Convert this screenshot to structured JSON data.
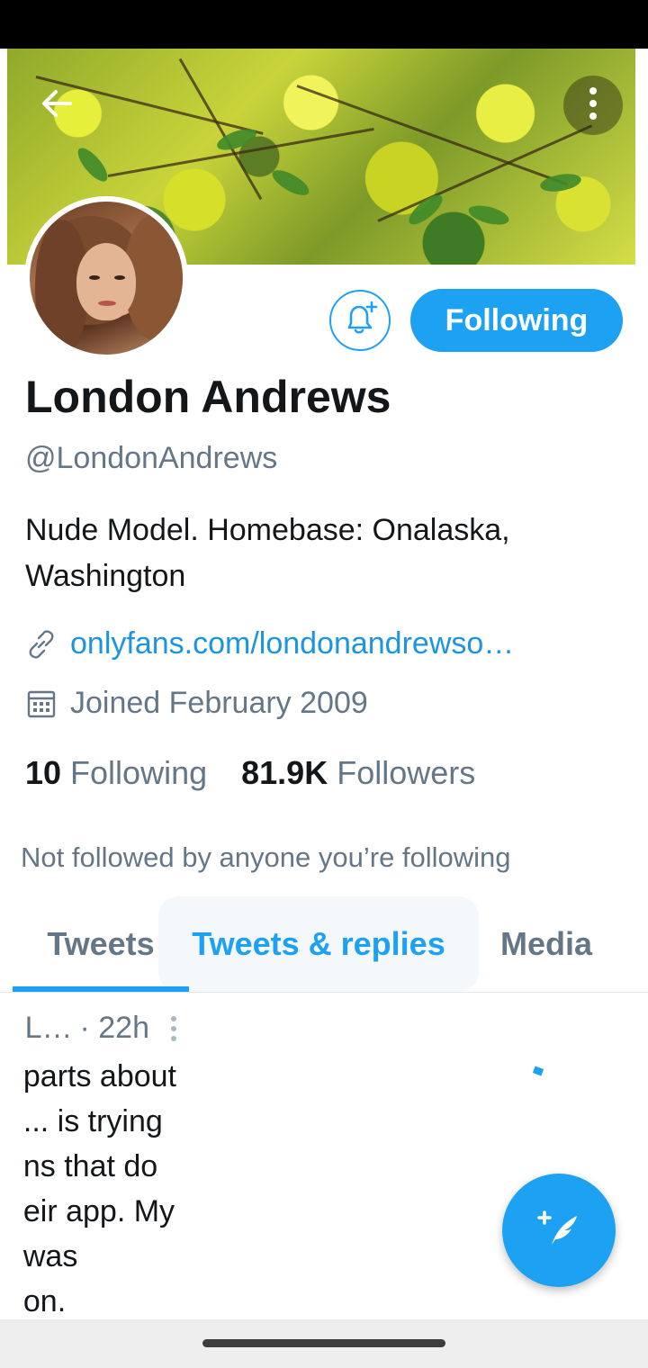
{
  "colors": {
    "accent": "#1da1f2",
    "link": "#1b95e0",
    "secondary_text": "#657786",
    "primary_text": "#14171a"
  },
  "header": {
    "back_icon": "arrow-left-icon",
    "more_icon": "more-vertical-icon"
  },
  "profile": {
    "display_name": "London Andrews",
    "handle": "@LondonAndrews",
    "bio_line1": "Nude Model. Homebase: Onalaska,",
    "bio_line2": "Washington",
    "website": "onlyfans.com/londonandrewso…",
    "joined": "Joined February 2009",
    "following_count": "10",
    "following_label": "Following",
    "followers_count": "81.9K",
    "followers_label": "Followers",
    "not_followed_text": "Not followed by anyone you’re following"
  },
  "actions": {
    "notify_icon": "bell-plus-icon",
    "following_button": "Following"
  },
  "tabs": [
    {
      "label": "Tweets",
      "active": true
    },
    {
      "label": "Tweets & replies",
      "active": false
    },
    {
      "label": "Media",
      "active": false
    }
  ],
  "tweet": {
    "author_fragment": "L…",
    "time": "· 22h",
    "lines": [
      "parts about",
      "... is trying",
      "ns that do",
      "eir app. My",
      " was",
      "on."
    ]
  },
  "fab": {
    "icon": "compose-tweet-icon"
  }
}
